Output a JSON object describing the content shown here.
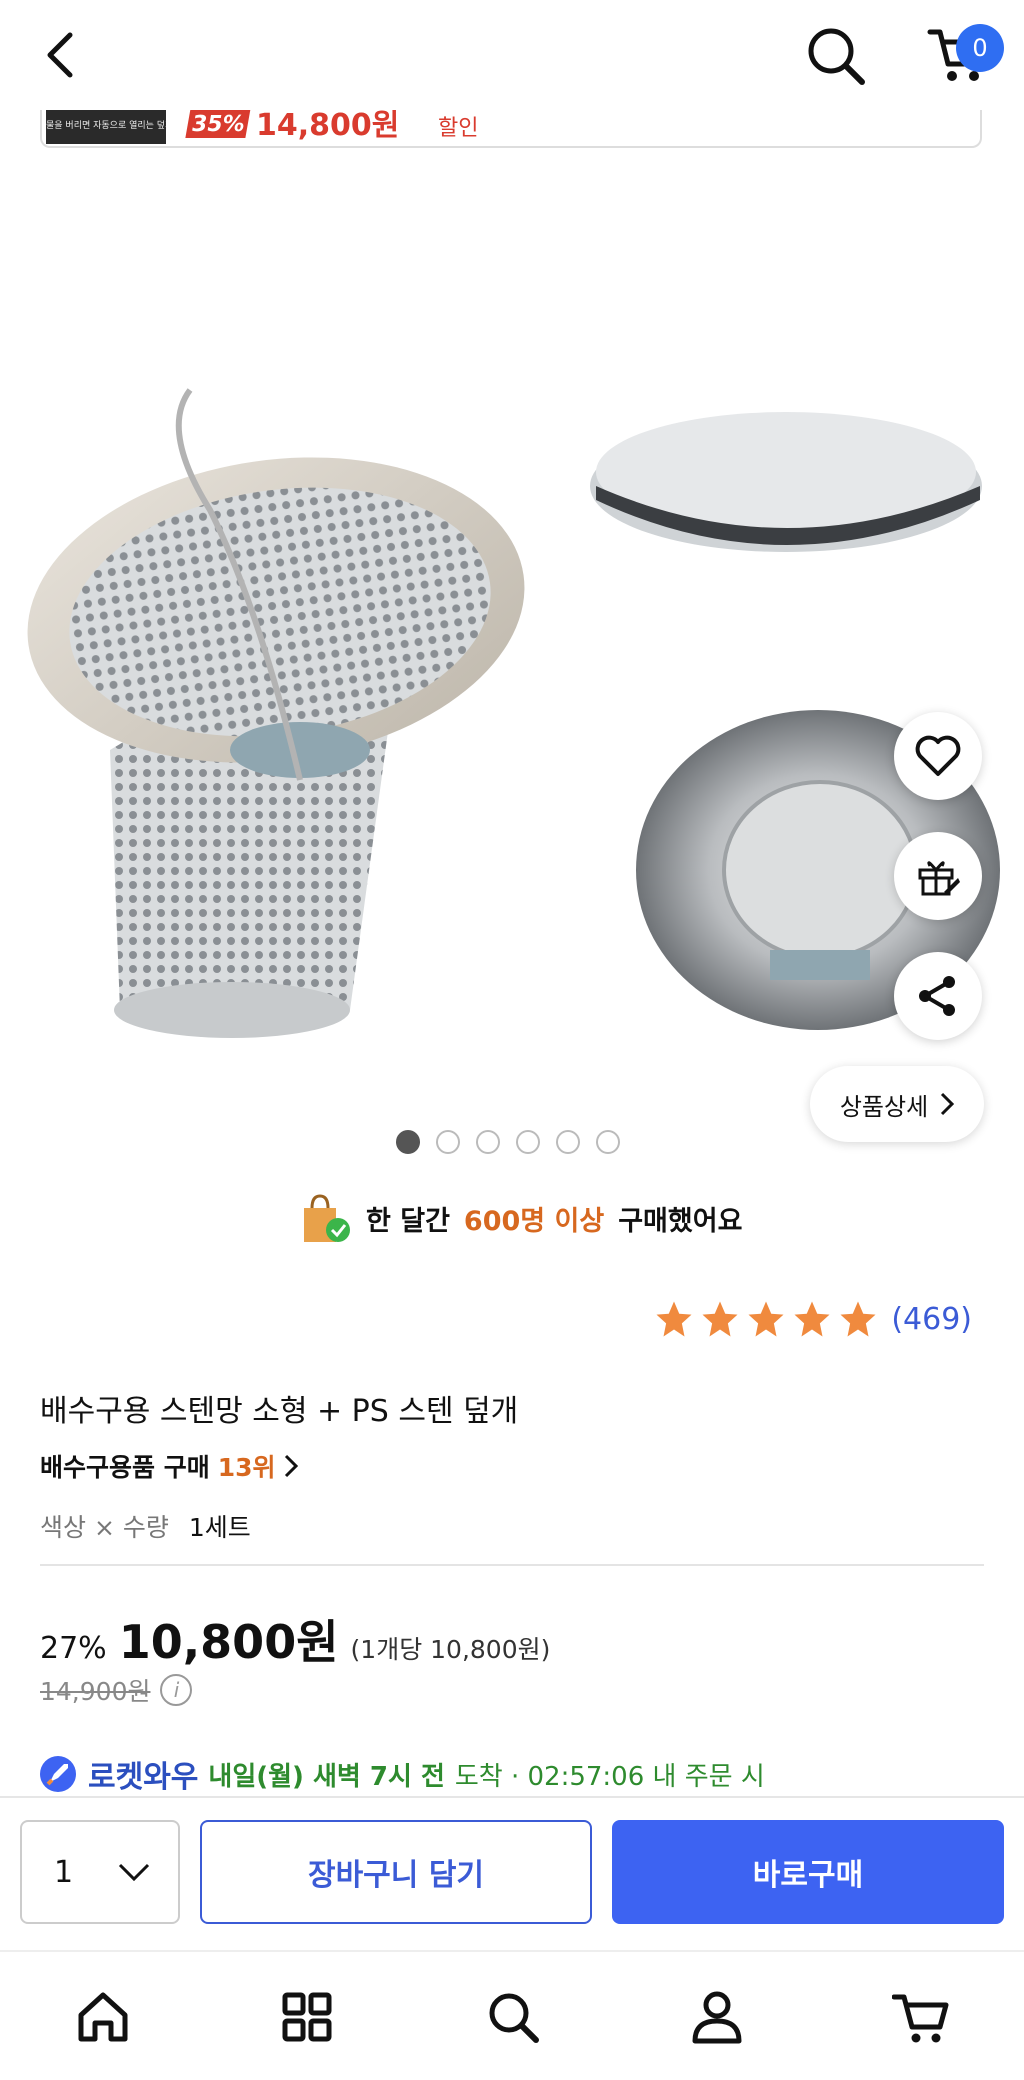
{
  "header": {
    "back_icon": "chevron-left-icon",
    "search_icon": "search-icon",
    "cart_icon": "cart-icon",
    "cart_count": "0",
    "accent": "#2f6ef2"
  },
  "peek_banner": {
    "thumb_caption": "물을 버리면 자동으로 열리는 덮개",
    "discount": "35%",
    "price": "14,800원",
    "suffix": "할인"
  },
  "gallery": {
    "dots_total": 6,
    "active_dot": 0,
    "wishlist_icon": "heart-icon",
    "gift_icon": "gift-icon",
    "share_icon": "share-icon",
    "detail_button": "상품상세"
  },
  "social_proof": {
    "prefix": "한 달간",
    "highlight": "600명 이상",
    "suffix": "구매했어요"
  },
  "rating": {
    "stars": 5,
    "review_count": "(469)",
    "star_color": "#f08a3e"
  },
  "product": {
    "title": "배수구용 스텐망 소형 + PS 스텐 덮개",
    "rank_label": "배수구용품 구매",
    "rank_value": "13위",
    "option_label": "색상 × 수량",
    "option_value": "1세트"
  },
  "price": {
    "discount_pct": "27%",
    "sale_price": "10,800원",
    "unit_price": "(1개당 10,800원)",
    "original_price": "14,900원"
  },
  "delivery": {
    "badge": "로켓와우",
    "date": "내일(월) 새벽 7시 전",
    "rest": "도착 · 02:57:06 내 주문 시"
  },
  "buy_bar": {
    "quantity": "1",
    "add_to_cart": "장바구니 담기",
    "buy_now": "바로구매",
    "primary_color": "#3d63f2"
  },
  "bottom_nav": {
    "items": [
      "home-icon",
      "category-icon",
      "search-icon",
      "my-page-icon",
      "cart-icon"
    ]
  }
}
